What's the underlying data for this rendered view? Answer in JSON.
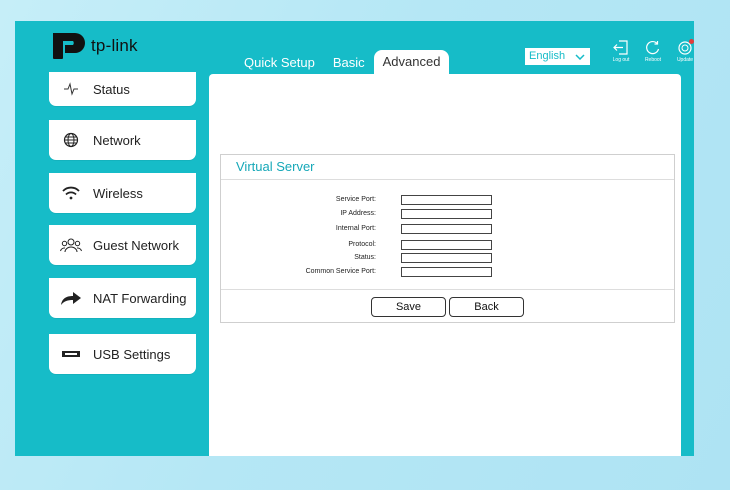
{
  "brand": {
    "name": "tp-link"
  },
  "tabs": [
    {
      "label": "Quick Setup"
    },
    {
      "label": "Basic"
    },
    {
      "label": "Advanced"
    }
  ],
  "language": {
    "selected": "English"
  },
  "top_actions": [
    {
      "label": "Log out",
      "icon": "logout-icon"
    },
    {
      "label": "Reboot",
      "icon": "reboot-icon"
    },
    {
      "label": "Update",
      "icon": "update-icon"
    }
  ],
  "sidebar": {
    "items": [
      {
        "label": "Status",
        "icon": "pulse-icon"
      },
      {
        "label": "Network",
        "icon": "globe-icon"
      },
      {
        "label": "Wireless",
        "icon": "wifi-icon"
      },
      {
        "label": "Guest Network",
        "icon": "users-icon"
      },
      {
        "label": "NAT Forwarding",
        "icon": "forward-arrow-icon"
      },
      {
        "label": "USB Settings",
        "icon": "usb-icon"
      }
    ]
  },
  "virtual_server": {
    "title": "Virtual Server",
    "fields": [
      {
        "label": "Service Port:",
        "value": ""
      },
      {
        "label": "IP Address:",
        "value": ""
      },
      {
        "label": "Internal Port:",
        "value": ""
      },
      {
        "label": "Protocol:",
        "value": ""
      },
      {
        "label": "Status:",
        "value": ""
      },
      {
        "label": "Common Service Port:",
        "value": ""
      }
    ],
    "save_label": "Save",
    "back_label": "Back"
  },
  "colors": {
    "brand_teal": "#16bcc8",
    "title_teal": "#16a8b8",
    "badge_red": "#e53b3b",
    "page_bg": "#b2e6f4"
  }
}
